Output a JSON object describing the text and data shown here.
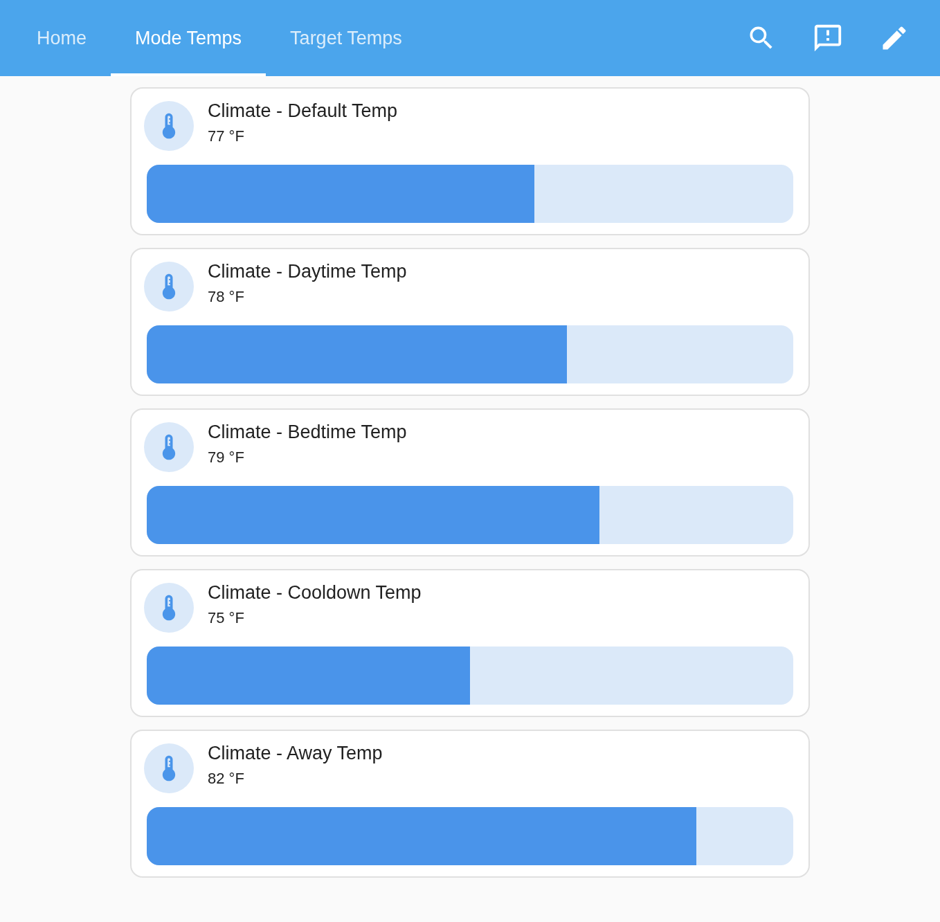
{
  "tabs": [
    {
      "label": "Home",
      "selected": false
    },
    {
      "label": "Mode Temps",
      "selected": true
    },
    {
      "label": "Target Temps",
      "selected": false
    }
  ],
  "cards": [
    {
      "title": "Climate - Default Temp",
      "value": "77 °F",
      "level": 0.6
    },
    {
      "title": "Climate - Daytime Temp",
      "value": "78 °F",
      "level": 0.65
    },
    {
      "title": "Climate - Bedtime Temp",
      "value": "79 °F",
      "level": 0.7
    },
    {
      "title": "Climate - Cooldown Temp",
      "value": "75 °F",
      "level": 0.5
    },
    {
      "title": "Climate - Away Temp",
      "value": "82 °F",
      "level": 0.85
    }
  ]
}
